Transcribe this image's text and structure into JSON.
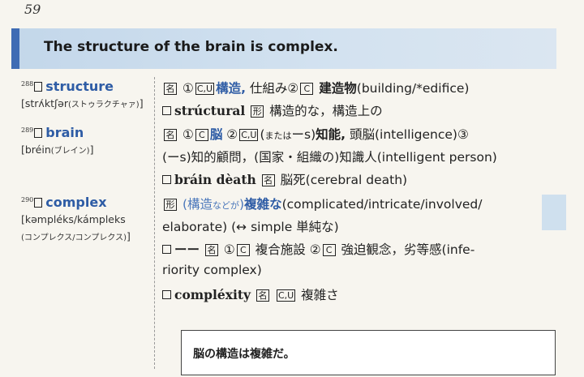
{
  "page_number": "59",
  "banner": {
    "sentence": "The structure of the brain is complex."
  },
  "entries": [
    {
      "number": "288",
      "headword": "structure",
      "pronunciation": "[strʌ́ktʃər",
      "kana": "(ストゥラクチャァ)",
      "close": "]",
      "lines": {
        "l1_pos": "名",
        "l1_n1": "①",
        "l1_t1": "C,U",
        "l1_jp1": "構造,",
        "l1_jp2": "仕組み",
        "l1_n2": "②",
        "l1_t2": "C",
        "l1_jp3": "建造物",
        "l1_en": "(building/*edifice)",
        "l2_word": "strúctural",
        "l2_pos": "形",
        "l2_jp": "構造的な，構造上の"
      }
    },
    {
      "number": "289",
      "headword": "brain",
      "pronunciation": "[bréin",
      "kana": "(ブレイン)",
      "close": "]",
      "lines": {
        "l1_pos": "名",
        "l1_n1": "①",
        "l1_t1": "C",
        "l1_jp1": "脳",
        "l1_n2": "②",
        "l1_t2": "C,U",
        "l1_open": "(",
        "l1_small": "または",
        "l1_s": "ーs)",
        "l1_jp2": "知能,",
        "l1_jp3": "頭脳",
        "l1_en": "(intelligence)③",
        "l2_text": "(ーs)知的顧問，(国家・組織の)知識人(intelligent person)",
        "l3_word": "bráin dèath",
        "l3_pos": "名",
        "l3_jp": "脳死(cerebral death)"
      }
    },
    {
      "number": "290",
      "headword": "complex",
      "pronunciation": "[kəmpléks/kámpleks",
      "kana": "(コンプレクス/コンプレクス)",
      "close": "]",
      "lines": {
        "l1_pos": "形",
        "l1_pre": "(構造",
        "l1_small": "などが",
        "l1_close": ")",
        "l1_jp": "複雑な",
        "l1_en": "(complicated/intricate/involved/",
        "l2_text": "elaborate) (↔ simple 単純な)",
        "l3_dash": "ーー",
        "l3_pos": "名",
        "l3_n1": "①",
        "l3_t1": "C",
        "l3_jp1": "複合施設",
        "l3_n2": "②",
        "l3_t2": "C",
        "l3_jp2": "強迫観念，劣等感(infe-",
        "l4_text": "riority complex)",
        "l5_word": "compléxity",
        "l5_pos": "名",
        "l5_t1": "C,U",
        "l5_jp": "複雑さ"
      }
    }
  ],
  "example": {
    "sentence": "脳の構造は複雑だ。"
  },
  "colors": {
    "accent": "#3f6cb4",
    "headword": "#2e5ca5",
    "banner_bg": "#c3d7ea"
  }
}
